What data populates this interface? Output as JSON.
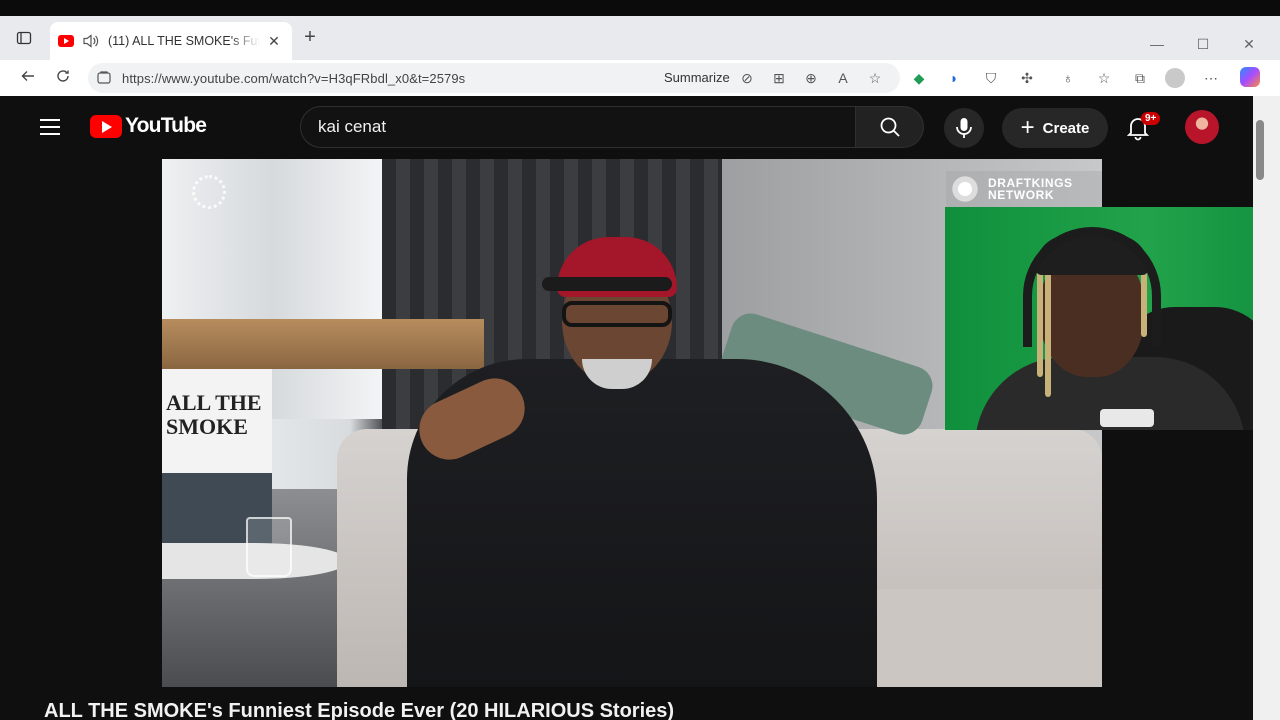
{
  "browser": {
    "tab_title": "(11) ALL THE SMOKE's Funniest Episode Ever (20 HILARIOUS Stories)",
    "url": "https://www.youtube.com/watch?v=H3qFRbdl_x0&t=2579s",
    "summarize_label": "Summarize",
    "new_tab_symbol": "+",
    "close_tab_symbol": "✕"
  },
  "youtube": {
    "logo_text": "YouTube",
    "search_value": "kai cenat",
    "create_label": "Create",
    "notification_badge": "9+"
  },
  "video": {
    "watermark_line1": "DRAFTKINGS",
    "watermark_line2": "NETWORK",
    "book_title_line1": "ALL THE",
    "book_title_line2": "SMOKE",
    "title": "ALL THE SMOKE's Funniest Episode Ever (20 HILARIOUS Stories)"
  },
  "colors": {
    "youtube_red": "#ff0000",
    "yt_background": "#0f0f0f",
    "chrome_tabbar": "#e9eaee"
  }
}
